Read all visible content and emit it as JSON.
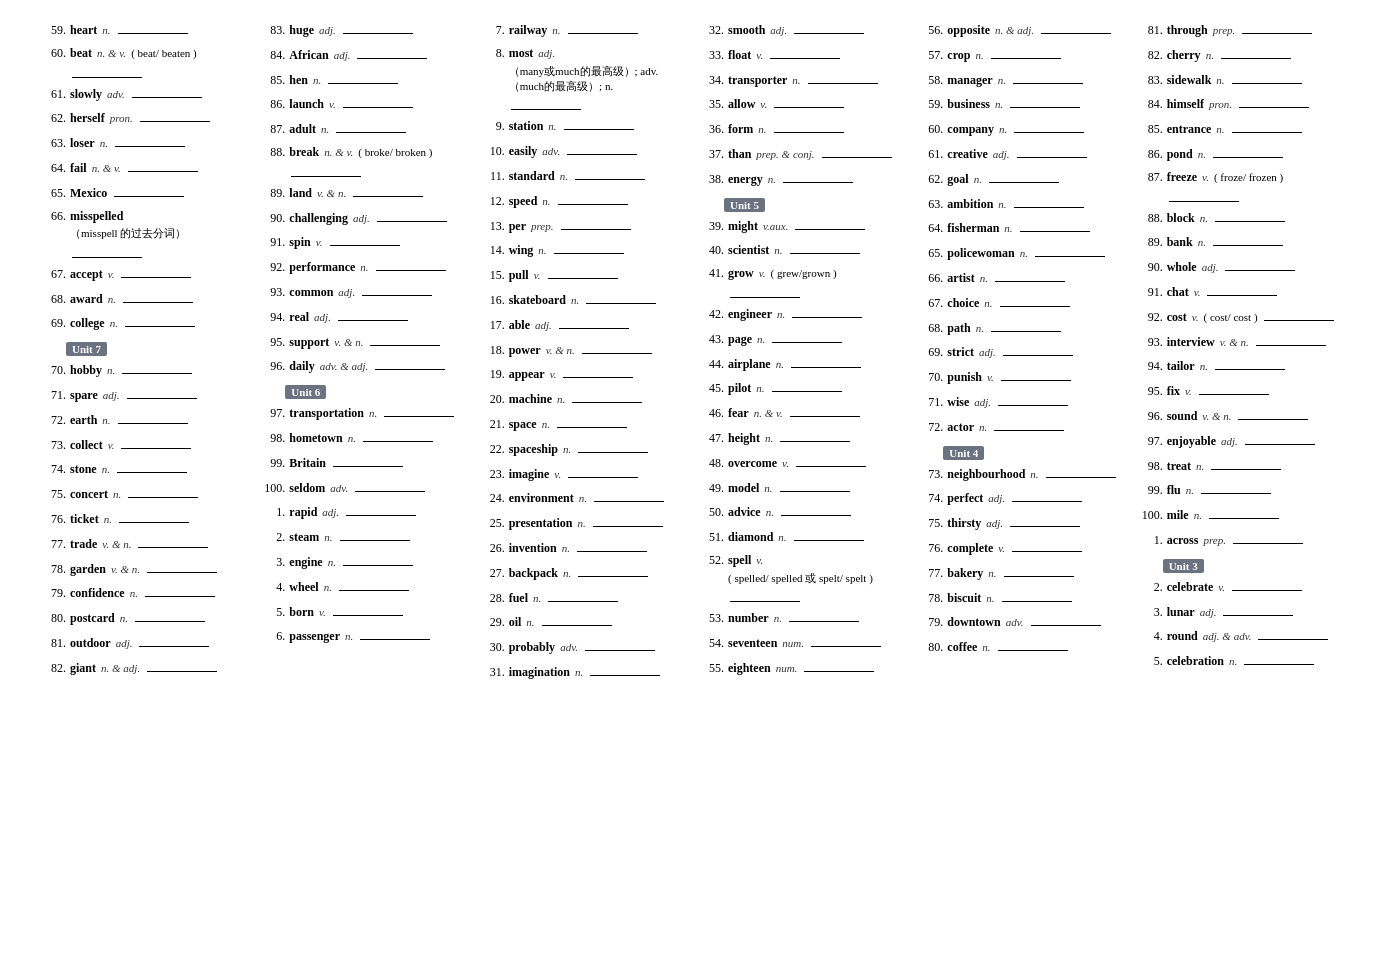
{
  "columns": [
    {
      "id": "col1",
      "entries": [
        {
          "num": "59.",
          "word": "heart",
          "pos": "n.",
          "blank": true
        },
        {
          "num": "60.",
          "word": "beat",
          "pos": "n. & v.",
          "note": "( beat/ beaten )",
          "blank": true
        },
        {
          "num": "61.",
          "word": "slowly",
          "pos": "adv.",
          "blank": true
        },
        {
          "num": "62.",
          "word": "herself",
          "pos": "pron.",
          "blank": true
        },
        {
          "num": "63.",
          "word": "loser",
          "pos": "n.",
          "blank": true
        },
        {
          "num": "64.",
          "word": "fail",
          "pos": "n. & v.",
          "blank": true
        },
        {
          "num": "65.",
          "word": "Mexico",
          "blank": true
        },
        {
          "num": "66.",
          "word": "misspelled",
          "note": "（misspell 的过去分词）",
          "blank": true
        },
        {
          "num": "67.",
          "word": "accept",
          "pos": "v.",
          "blank": true
        },
        {
          "num": "68.",
          "word": "award",
          "pos": "n.",
          "blank": true
        },
        {
          "num": "69.",
          "word": "college",
          "pos": "n.",
          "blank": true
        },
        {
          "unit": "Unit 7"
        },
        {
          "num": "70.",
          "word": "hobby",
          "pos": "n.",
          "blank": true
        },
        {
          "num": "71.",
          "word": "spare",
          "pos": "adj.",
          "blank": true
        },
        {
          "num": "72.",
          "word": "earth",
          "pos": "n.",
          "blank": true
        },
        {
          "num": "73.",
          "word": "collect",
          "pos": "v.",
          "blank": true
        },
        {
          "num": "74.",
          "word": "stone",
          "pos": "n.",
          "blank": true
        },
        {
          "num": "75.",
          "word": "concert",
          "pos": "n.",
          "blank": true
        },
        {
          "num": "76.",
          "word": "ticket",
          "pos": "n.",
          "blank": true
        },
        {
          "num": "77.",
          "word": "trade",
          "pos": "v. & n.",
          "blank": true
        },
        {
          "num": "78.",
          "word": "garden",
          "pos": "v. & n.",
          "blank": true
        },
        {
          "num": "79.",
          "word": "confidence",
          "pos": "n.",
          "blank": true
        },
        {
          "num": "80.",
          "word": "postcard",
          "pos": "n.",
          "blank": true
        },
        {
          "num": "81.",
          "word": "outdoor",
          "pos": "adj.",
          "blank": true
        },
        {
          "num": "82.",
          "word": "giant",
          "pos": "n. & adj.",
          "blank": true
        }
      ]
    },
    {
      "id": "col2",
      "entries": [
        {
          "num": "83.",
          "word": "huge",
          "pos": "adj.",
          "blank": true
        },
        {
          "num": "84.",
          "word": "African",
          "pos": "adj.",
          "blank": true
        },
        {
          "num": "85.",
          "word": "hen",
          "pos": "n.",
          "blank": true
        },
        {
          "num": "86.",
          "word": "launch",
          "pos": "v.",
          "blank": true
        },
        {
          "num": "87.",
          "word": "adult",
          "pos": "n.",
          "blank": true
        },
        {
          "num": "88.",
          "word": "break",
          "pos": "n. & v.",
          "note": "( broke/ broken )",
          "blank": true
        },
        {
          "num": "89.",
          "word": "land",
          "pos": "v. & n.",
          "blank": true
        },
        {
          "num": "90.",
          "word": "challenging",
          "pos": "adj.",
          "blank": true
        },
        {
          "num": "91.",
          "word": "spin",
          "pos": "v.",
          "blank": true
        },
        {
          "num": "92.",
          "word": "performance",
          "pos": "n.",
          "blank": true
        },
        {
          "num": "93.",
          "word": "common",
          "pos": "adj.",
          "blank": true
        },
        {
          "num": "94.",
          "word": "real",
          "pos": "adj.",
          "blank": true
        },
        {
          "num": "95.",
          "word": "support",
          "pos": "v. & n.",
          "blank": true
        },
        {
          "num": "96.",
          "word": "daily",
          "pos": "adv. & adj.",
          "blank": true
        },
        {
          "unit": "Unit 6"
        },
        {
          "num": "97.",
          "word": "transportation",
          "pos": "n.",
          "blank": true
        },
        {
          "num": "98.",
          "word": "hometown",
          "pos": "n.",
          "blank": true
        },
        {
          "num": "99.",
          "word": "Britain",
          "blank": true
        },
        {
          "num": "100.",
          "word": "seldom",
          "pos": "adv.",
          "blank": true
        },
        {
          "num": "1.",
          "word": "rapid",
          "pos": "adj.",
          "blank": true
        },
        {
          "num": "2.",
          "word": "steam",
          "pos": "n.",
          "blank": true
        },
        {
          "num": "3.",
          "word": "engine",
          "pos": "n.",
          "blank": true
        },
        {
          "num": "4.",
          "word": "wheel",
          "pos": "n.",
          "blank": true
        },
        {
          "num": "5.",
          "word": "born",
          "pos": "v.",
          "blank": true
        },
        {
          "num": "6.",
          "word": "passenger",
          "pos": "n.",
          "blank": true
        }
      ]
    },
    {
      "id": "col3",
      "entries": [
        {
          "num": "7.",
          "word": "railway",
          "pos": "n.",
          "blank": true
        },
        {
          "num": "8.",
          "word": "most",
          "pos": "adj.",
          "note": "（many或much的最高级）; adv.（much的最高级）; n.",
          "blank": true
        },
        {
          "num": "9.",
          "word": "station",
          "pos": "n.",
          "blank": true
        },
        {
          "num": "10.",
          "word": "easily",
          "pos": "adv.",
          "blank": true
        },
        {
          "num": "11.",
          "word": "standard",
          "pos": "n.",
          "blank": true
        },
        {
          "num": "12.",
          "word": "speed",
          "pos": "n.",
          "blank": true
        },
        {
          "num": "13.",
          "word": "per",
          "pos": "prep.",
          "blank": true
        },
        {
          "num": "14.",
          "word": "wing",
          "pos": "n.",
          "blank": true
        },
        {
          "num": "15.",
          "word": "pull",
          "pos": "v.",
          "blank": true
        },
        {
          "num": "16.",
          "word": "skateboard",
          "pos": "n.",
          "blank": true
        },
        {
          "num": "17.",
          "word": "able",
          "pos": "adj.",
          "blank": true
        },
        {
          "num": "18.",
          "word": "power",
          "pos": "v. & n.",
          "blank": true
        },
        {
          "num": "19.",
          "word": "appear",
          "pos": "v.",
          "blank": true
        },
        {
          "num": "20.",
          "word": "machine",
          "pos": "n.",
          "blank": true
        },
        {
          "num": "21.",
          "word": "space",
          "pos": "n.",
          "blank": true
        },
        {
          "num": "22.",
          "word": "spaceship",
          "pos": "n.",
          "blank": true
        },
        {
          "num": "23.",
          "word": "imagine",
          "pos": "v.",
          "blank": true
        },
        {
          "num": "24.",
          "word": "environment",
          "pos": "n.",
          "blank": true
        },
        {
          "num": "25.",
          "word": "presentation",
          "pos": "n.",
          "blank": true
        },
        {
          "num": "26.",
          "word": "invention",
          "pos": "n.",
          "blank": true
        },
        {
          "num": "27.",
          "word": "backpack",
          "pos": "n.",
          "blank": true
        },
        {
          "num": "28.",
          "word": "fuel",
          "pos": "n.",
          "blank": true
        },
        {
          "num": "29.",
          "word": "oil",
          "pos": "n.",
          "blank": true
        },
        {
          "num": "30.",
          "word": "probably",
          "pos": "adv.",
          "blank": true
        },
        {
          "num": "31.",
          "word": "imagination",
          "pos": "n.",
          "blank": true
        }
      ]
    },
    {
      "id": "col4",
      "entries": [
        {
          "num": "32.",
          "word": "smooth",
          "pos": "adj.",
          "blank": true
        },
        {
          "num": "33.",
          "word": "float",
          "pos": "v.",
          "blank": true
        },
        {
          "num": "34.",
          "word": "transporter",
          "pos": "n.",
          "blank": true
        },
        {
          "num": "35.",
          "word": "allow",
          "pos": "v.",
          "blank": true
        },
        {
          "num": "36.",
          "word": "form",
          "pos": "n.",
          "blank": true
        },
        {
          "num": "37.",
          "word": "than",
          "pos": "prep. & conj.",
          "blank": true
        },
        {
          "num": "38.",
          "word": "energy",
          "pos": "n.",
          "blank": true
        },
        {
          "unit": "Unit 5"
        },
        {
          "num": "39.",
          "word": "might",
          "pos": "v.aux.",
          "blank": true
        },
        {
          "num": "40.",
          "word": "scientist",
          "pos": "n.",
          "blank": true
        },
        {
          "num": "41.",
          "word": "grow",
          "pos": "v.",
          "note": "( grew/grown )",
          "blank": true
        },
        {
          "num": "42.",
          "word": "engineer",
          "pos": "n.",
          "blank": true
        },
        {
          "num": "43.",
          "word": "page",
          "pos": "n.",
          "blank": true
        },
        {
          "num": "44.",
          "word": "airplane",
          "pos": "n.",
          "blank": true
        },
        {
          "num": "45.",
          "word": "pilot",
          "pos": "n.",
          "blank": true
        },
        {
          "num": "46.",
          "word": "fear",
          "pos": "n. & v.",
          "blank": true
        },
        {
          "num": "47.",
          "word": "height",
          "pos": "n.",
          "blank": true
        },
        {
          "num": "48.",
          "word": "overcome",
          "pos": "v.",
          "blank": true
        },
        {
          "num": "49.",
          "word": "model",
          "pos": "n.",
          "blank": true
        },
        {
          "num": "50.",
          "word": "advice",
          "pos": "n.",
          "blank": true
        },
        {
          "num": "51.",
          "word": "diamond",
          "pos": "n.",
          "blank": true
        },
        {
          "num": "52.",
          "word": "spell",
          "pos": "v.",
          "note": "( spelled/ spelled 或 spelt/ spelt )",
          "blank": true
        },
        {
          "num": "53.",
          "word": "number",
          "pos": "n.",
          "blank": true
        },
        {
          "num": "54.",
          "word": "seventeen",
          "pos": "num.",
          "blank": true
        },
        {
          "num": "55.",
          "word": "eighteen",
          "pos": "num.",
          "blank": true
        }
      ]
    },
    {
      "id": "col5",
      "entries": [
        {
          "num": "56.",
          "word": "opposite",
          "pos": "n. & adj.",
          "blank": true
        },
        {
          "num": "57.",
          "word": "crop",
          "pos": "n.",
          "blank": true
        },
        {
          "num": "58.",
          "word": "manager",
          "pos": "n.",
          "blank": true
        },
        {
          "num": "59.",
          "word": "business",
          "pos": "n.",
          "blank": true
        },
        {
          "num": "60.",
          "word": "company",
          "pos": "n.",
          "blank": true
        },
        {
          "num": "61.",
          "word": "creative",
          "pos": "adj.",
          "blank": true
        },
        {
          "num": "62.",
          "word": "goal",
          "pos": "n.",
          "blank": true
        },
        {
          "num": "63.",
          "word": "ambition",
          "pos": "n.",
          "blank": true
        },
        {
          "num": "64.",
          "word": "fisherman",
          "pos": "n.",
          "blank": true
        },
        {
          "num": "65.",
          "word": "policewoman",
          "pos": "n.",
          "blank": true
        },
        {
          "num": "66.",
          "word": "artist",
          "pos": "n.",
          "blank": true
        },
        {
          "num": "67.",
          "word": "choice",
          "pos": "n.",
          "blank": true
        },
        {
          "num": "68.",
          "word": "path",
          "pos": "n.",
          "blank": true
        },
        {
          "num": "69.",
          "word": "strict",
          "pos": "adj.",
          "blank": true
        },
        {
          "num": "70.",
          "word": "punish",
          "pos": "v.",
          "blank": true
        },
        {
          "num": "71.",
          "word": "wise",
          "pos": "adj.",
          "blank": true
        },
        {
          "num": "72.",
          "word": "actor",
          "pos": "n.",
          "blank": true
        },
        {
          "unit": "Unit 4"
        },
        {
          "num": "73.",
          "word": "neighbourhood",
          "pos": "n.",
          "blank": true
        },
        {
          "num": "74.",
          "word": "perfect",
          "pos": "adj.",
          "blank": true
        },
        {
          "num": "75.",
          "word": "thirsty",
          "pos": "adj.",
          "blank": true
        },
        {
          "num": "76.",
          "word": "complete",
          "pos": "v.",
          "blank": true
        },
        {
          "num": "77.",
          "word": "bakery",
          "pos": "n.",
          "blank": true
        },
        {
          "num": "78.",
          "word": "biscuit",
          "pos": "n.",
          "blank": true
        },
        {
          "num": "79.",
          "word": "downtown",
          "pos": "adv.",
          "blank": true
        },
        {
          "num": "80.",
          "word": "coffee",
          "pos": "n.",
          "blank": true
        }
      ]
    },
    {
      "id": "col6",
      "entries": [
        {
          "num": "81.",
          "word": "through",
          "pos": "prep.",
          "blank": true
        },
        {
          "num": "82.",
          "word": "cherry",
          "pos": "n.",
          "blank": true
        },
        {
          "num": "83.",
          "word": "sidewalk",
          "pos": "n.",
          "blank": true
        },
        {
          "num": "84.",
          "word": "himself",
          "pos": "pron.",
          "blank": true
        },
        {
          "num": "85.",
          "word": "entrance",
          "pos": "n.",
          "blank": true
        },
        {
          "num": "86.",
          "word": "pond",
          "pos": "n.",
          "blank": true
        },
        {
          "num": "87.",
          "word": "freeze",
          "pos": "v.",
          "note": "( froze/ frozen )",
          "blank": true
        },
        {
          "num": "88.",
          "word": "block",
          "pos": "n.",
          "blank": true
        },
        {
          "num": "89.",
          "word": "bank",
          "pos": "n.",
          "blank": true
        },
        {
          "num": "90.",
          "word": "whole",
          "pos": "adj.",
          "blank": true
        },
        {
          "num": "91.",
          "word": "chat",
          "pos": "v.",
          "blank": true
        },
        {
          "num": "92.",
          "word": "cost",
          "pos": "v.",
          "note": "( cost/ cost )",
          "blank": true
        },
        {
          "num": "93.",
          "word": "interview",
          "pos": "v. & n.",
          "blank": true
        },
        {
          "num": "94.",
          "word": "tailor",
          "pos": "n.",
          "blank": true
        },
        {
          "num": "95.",
          "word": "fix",
          "pos": "v.",
          "blank": true
        },
        {
          "num": "96.",
          "word": "sound",
          "pos": "v. & n.",
          "blank": true
        },
        {
          "num": "97.",
          "word": "enjoyable",
          "pos": "adj.",
          "blank": true
        },
        {
          "num": "98.",
          "word": "treat",
          "pos": "n.",
          "blank": true
        },
        {
          "num": "99.",
          "word": "flu",
          "pos": "n.",
          "blank": true
        },
        {
          "num": "100.",
          "word": "mile",
          "pos": "n.",
          "blank": true
        },
        {
          "num": "1.",
          "word": "across",
          "pos": "prep.",
          "blank": true
        },
        {
          "unit": "Unit 3"
        },
        {
          "num": "2.",
          "word": "celebrate",
          "pos": "v.",
          "blank": true
        },
        {
          "num": "3.",
          "word": "lunar",
          "pos": "adj.",
          "blank": true
        },
        {
          "num": "4.",
          "word": "round",
          "pos": "adj. & adv.",
          "blank": true
        },
        {
          "num": "5.",
          "word": "celebration",
          "pos": "n.",
          "blank": true
        }
      ]
    }
  ]
}
